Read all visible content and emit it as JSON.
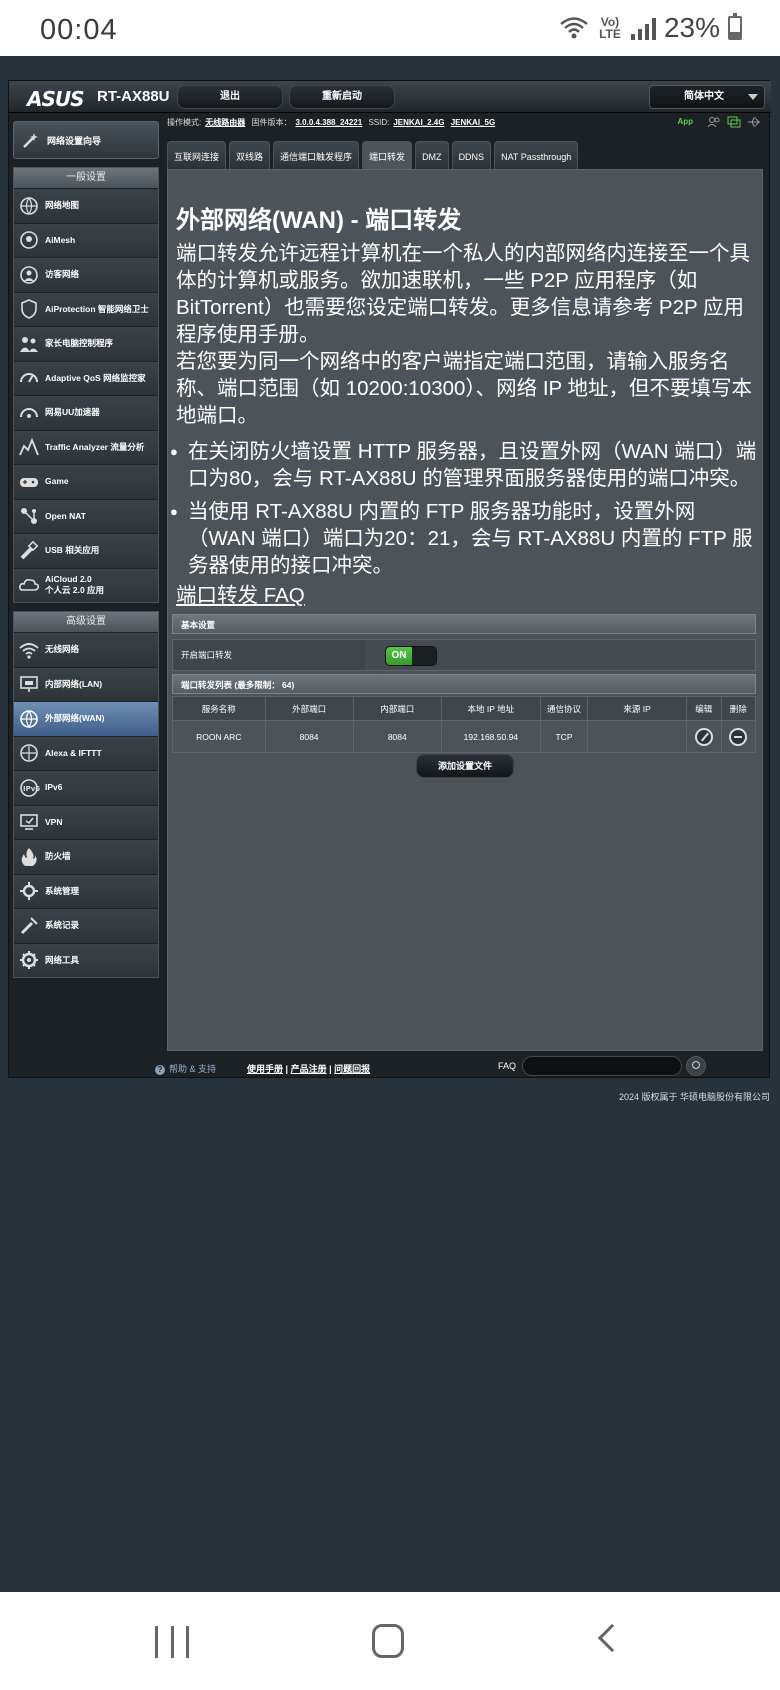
{
  "status_bar": {
    "time": "00:04",
    "network": "Vo) LTE",
    "battery": "23%"
  },
  "router": {
    "brand": "ASUS",
    "model": "RT-AX88U",
    "logout_label": "退出",
    "reboot_label": "重新启动",
    "language": "简体中文"
  },
  "sidebar": {
    "qis_label": "网络设置向导",
    "general_header": "一般设置",
    "general_items": [
      {
        "label": "网络地图",
        "icon": "globe-icon"
      },
      {
        "label": "AiMesh",
        "icon": "mesh-icon"
      },
      {
        "label": "访客网络",
        "icon": "guest-network-icon"
      },
      {
        "label": "AiProtection 智能网络卫士",
        "icon": "shield-icon"
      },
      {
        "label": "家长电脑控制程序",
        "icon": "family-icon"
      },
      {
        "label": "Adaptive QoS 网络监控家",
        "icon": "gauge-icon"
      },
      {
        "label": "网易UU加速器",
        "icon": "speed-icon"
      },
      {
        "label": "Traffic Analyzer 流量分析",
        "icon": "chart-icon"
      },
      {
        "label": "Game",
        "icon": "gamepad-icon"
      },
      {
        "label": "Open NAT",
        "icon": "nat-icon"
      },
      {
        "label": "USB 相关应用",
        "icon": "usb-icon"
      },
      {
        "label_line1": "AiCloud 2.0",
        "label_line2": "个人云 2.0 应用",
        "icon": "cloud-icon"
      }
    ],
    "advanced_header": "高级设置",
    "advanced_items": [
      {
        "label": "无线网络",
        "icon": "wifi-icon"
      },
      {
        "label": "内部网络(LAN)",
        "icon": "lan-icon"
      },
      {
        "label": "外部网络(WAN)",
        "icon": "wan-globe-icon",
        "active": true
      },
      {
        "label": "Alexa & IFTTT",
        "icon": "alexa-icon"
      },
      {
        "label": "IPv6",
        "icon": "ipv6-icon"
      },
      {
        "label": "VPN",
        "icon": "vpn-icon"
      },
      {
        "label": "防火墙",
        "icon": "firewall-icon"
      },
      {
        "label": "系统管理",
        "icon": "admin-icon"
      },
      {
        "label": "系统记录",
        "icon": "log-icon"
      },
      {
        "label": "网络工具",
        "icon": "tools-icon"
      }
    ]
  },
  "infobar": {
    "mode_label": "操作模式:",
    "mode_value": "无线路由器",
    "firmware_label": "固件版本：",
    "firmware_value": "3.0.0.4.388_24221",
    "ssid_label": "SSID:",
    "ssid_24": "JENKAI_2.4G",
    "ssid_5": "JENKAI_5G",
    "app_label": "App"
  },
  "tabs": [
    "互联网连接",
    "双线路",
    "通信端口触发程序",
    "端口转发",
    "DMZ",
    "DDNS",
    "NAT Passthrough"
  ],
  "active_tab": "端口转发",
  "main": {
    "title": "外部网络(WAN) - 端口转发",
    "desc1": "端口转发允许远程计算机在一个私人的内部网络内连接至一个具体的计算机或服务。欲加速联机，一些 P2P 应用程序（如 BitTorrent）也需要您设定端口转发。更多信息请参考 P2P 应用程序使用手册。",
    "desc2": "若您要为同一个网络中的客户端指定端口范围，请输入服务名称、端口范围（如 10200:10300）、网络 IP 地址，但不要填写本地端口。",
    "bullet1": "在关闭防火墙设置 HTTP 服务器，且设置外网（WAN 端口）端口为80，会与 RT-AX88U 的管理界面服务器使用的端口冲突。",
    "bullet2": "当使用 RT-AX88U 内置的 FTP 服务器功能时，设置外网（WAN 端口）端口为20：21，会与 RT-AX88U 内置的 FTP 服务器使用的接口冲突。",
    "faq_link": "端口转发 FAQ",
    "basic_header": "基本设置",
    "enable_label": "开启端口转发",
    "toggle_state": "ON",
    "list_header": "端口转发列表 (最多限制： 64)",
    "columns": [
      "服务名称",
      "外部端口",
      "内部端口",
      "本地 IP 地址",
      "通信协议",
      "来源 IP",
      "编辑",
      "删除"
    ],
    "rows": [
      {
        "service": "ROON ARC",
        "ext_port": "8084",
        "int_port": "8084",
        "ip": "192.168.50.94",
        "protocol": "TCP",
        "source_ip": ""
      }
    ],
    "add_button": "添加设置文件"
  },
  "footer": {
    "help": "帮助 & 支持",
    "manual": "使用手册",
    "register": "产品注册",
    "feedback": "问题回报",
    "sep": "|",
    "faq_label": "FAQ",
    "copyright": "2024 版权属于 华硕电脑股份有限公司"
  },
  "colors": {
    "accent_green": "#5ecc47",
    "active_item": "#4f6f9a",
    "background": "#27323b"
  }
}
